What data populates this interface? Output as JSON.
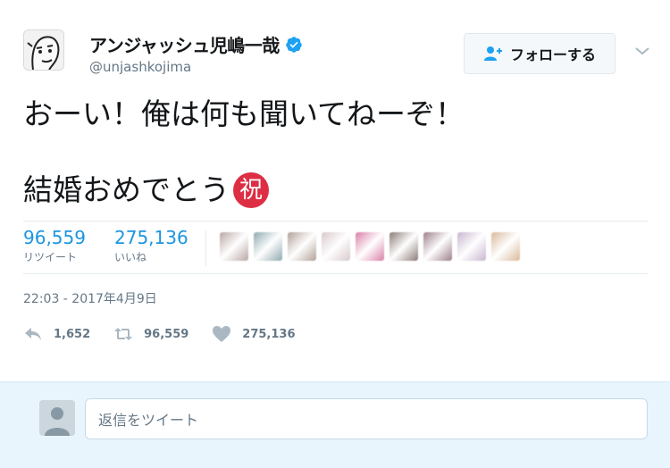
{
  "user": {
    "display_name": "アンジャッシュ児嶋一哉",
    "handle": "@unjashkojima",
    "verified": true
  },
  "follow_button": {
    "label": "フォローする",
    "icon": "add-user-icon"
  },
  "tweet": {
    "line1": "おーい！俺は何も聞いてねーぞ！",
    "line2": "結婚おめでとう",
    "emoji": "祝"
  },
  "stats": {
    "retweets": {
      "count": "96,559",
      "label": "リツイート"
    },
    "likes": {
      "count": "275,136",
      "label": "いいね"
    }
  },
  "liker_colors": [
    "#b9a7a5",
    "#8fa9b0",
    "#b2a197",
    "#d8c9cc",
    "#d97fa7",
    "#8a7b76",
    "#9b7f8b",
    "#c8b6cf",
    "#d9b99a"
  ],
  "timestamp": "22:03 - 2017年4月9日",
  "actions": {
    "reply_count": "1,652",
    "retweet_count": "96,559",
    "like_count": "275,136"
  },
  "reply_box": {
    "placeholder": "返信をツイート"
  },
  "colors": {
    "accent": "#1b95e0",
    "celebrate": "#dd2e44",
    "reply_bg": "#e8f5fd"
  }
}
